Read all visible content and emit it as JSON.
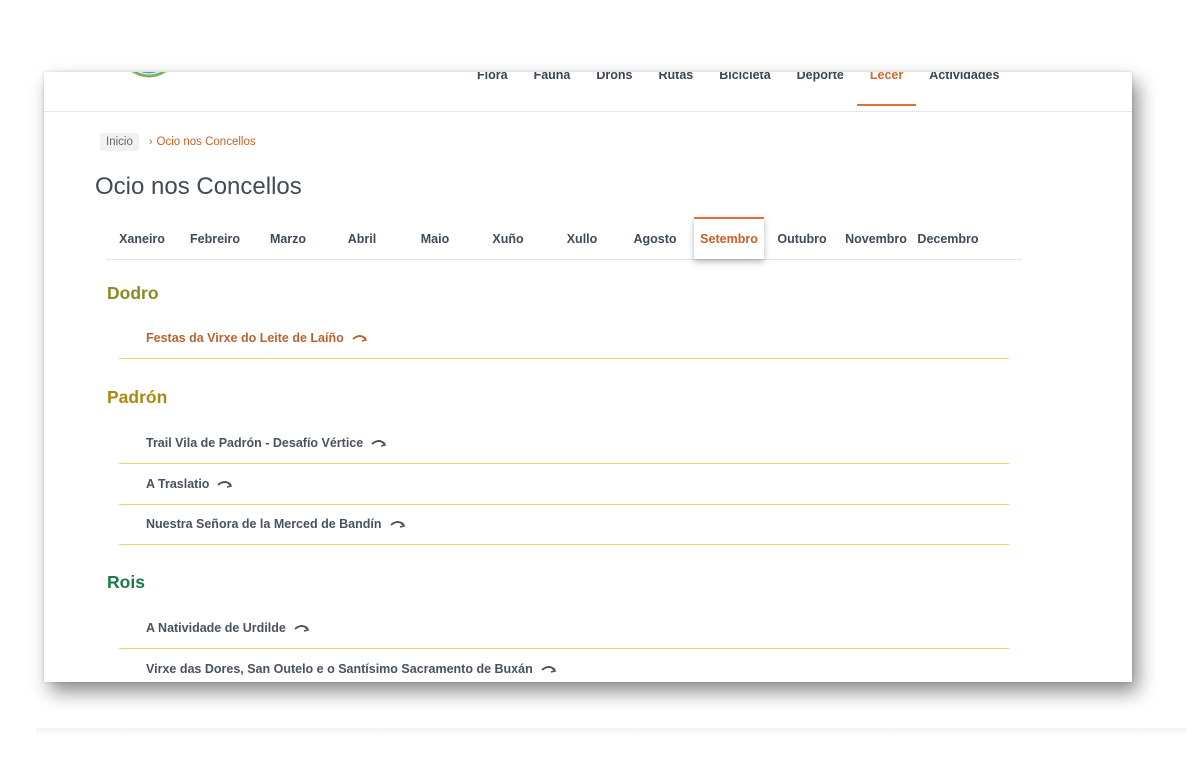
{
  "topnav": {
    "items": [
      {
        "label": "Flora",
        "active": false
      },
      {
        "label": "Fauna",
        "active": false
      },
      {
        "label": "Drons",
        "active": false
      },
      {
        "label": "Rutas",
        "active": false
      },
      {
        "label": "Bicicleta",
        "active": false
      },
      {
        "label": "Deporte",
        "active": false
      },
      {
        "label": "Lecer",
        "active": true
      },
      {
        "label": "Actividades",
        "active": false
      }
    ]
  },
  "breadcrumb": {
    "home": "Inicio",
    "separator": "›",
    "current": "Ocio nos Concellos"
  },
  "page_title": "Ocio nos Concellos",
  "months": {
    "items": [
      "Xaneiro",
      "Febreiro",
      "Marzo",
      "Abril",
      "Maio",
      "Xuño",
      "Xullo",
      "Agosto",
      "Setembro",
      "Outubro",
      "Novembro",
      "Decembro"
    ],
    "active": "Setembro"
  },
  "sections": [
    {
      "name": "Dodro",
      "color": "#8a8a22",
      "events": [
        {
          "label": "Festas da Virxe do Leite de Laíño",
          "highlight": true
        }
      ]
    },
    {
      "name": "Padrón",
      "color": "#a88a10",
      "events": [
        {
          "label": "Trail Vila de Padrón - Desafío Vértice",
          "highlight": false
        },
        {
          "label": "A Traslatio",
          "highlight": false
        },
        {
          "label": "Nuestra Señora de la Merced de Bandín",
          "highlight": false
        }
      ]
    },
    {
      "name": "Rois",
      "color": "#1f7a4a",
      "events": [
        {
          "label": "A Natividade de Urdilde",
          "highlight": false
        },
        {
          "label": "Virxe das Dores, San Outelo e o Santísimo Sacramento de Buxán",
          "highlight": false
        }
      ]
    }
  ],
  "icons": {
    "event_arrow": "curved-arrow-icon"
  },
  "colors": {
    "accent": "#e0703a",
    "event_underline": "#ecd36a",
    "text": "#3f4a5a"
  }
}
